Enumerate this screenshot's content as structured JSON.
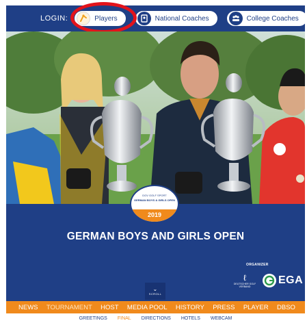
{
  "login": {
    "label": "LOGIN:",
    "buttons": [
      {
        "label": "Players",
        "icon": "golfer-icon"
      },
      {
        "label": "National Coaches",
        "icon": "coach-icon"
      },
      {
        "label": "College Coaches",
        "icon": "group-icon"
      }
    ]
  },
  "badge": {
    "header": "DGV GOLF SPORT",
    "name": "GERMAN BOYS & GIRLS OPEN",
    "year": "2019"
  },
  "title": "GERMAN BOYS AND GIRLS OPEN",
  "organizer": {
    "label": "ORGANIZER",
    "dgv_caption": "DEUTSCHER GOLF VERBAND",
    "ega_text": "EGA",
    "ega_caption": "European Golf Association"
  },
  "scroll": {
    "label": "SCROLL"
  },
  "nav": {
    "items": [
      "NEWS",
      "TOURNAMENT",
      "HOST",
      "MEDIA POOL",
      "HISTORY",
      "PRESS",
      "PLAYER",
      "DBSO"
    ],
    "active_index": 1
  },
  "subnav": {
    "items": [
      "GREETINGS",
      "FINAL",
      "DIRECTIONS",
      "HOTELS",
      "WEBCAM"
    ],
    "active_index": 1
  },
  "colors": {
    "primary_blue": "#1f3f86",
    "accent_orange": "#f08a1c",
    "highlight_red": "#e3131b"
  }
}
